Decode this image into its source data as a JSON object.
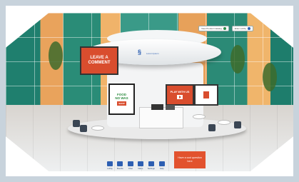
{
  "booth": {
    "leave_comment": "LEAVE A COMMENT",
    "logo_mark": "§",
    "logo_text": "Lorem Ipsum",
    "food_sign_title": "FOOD\nNO WAS",
    "food_sign_tag": "SHOP",
    "play_label": "PLAY WITH US",
    "video_icon": "play-icon",
    "pdf_icon": "pdf-icon"
  },
  "topbar": {
    "items": [
      {
        "label": "View Product Catalog",
        "icon_color": "#2a8c4a"
      },
      {
        "label": "Enter Lobby",
        "icon_color": "#2d5fb2"
      }
    ]
  },
  "cta": {
    "label": "Have a cool question\nhere"
  },
  "dock": {
    "items": [
      {
        "label": "Lobby",
        "icon": "home-icon"
      },
      {
        "label": "Booths",
        "icon": "booth-icon"
      },
      {
        "label": "Chat",
        "icon": "chat-icon"
      },
      {
        "label": "Video",
        "icon": "video-icon"
      },
      {
        "label": "Settings",
        "icon": "gear-icon"
      },
      {
        "label": "Help",
        "icon": "help-icon"
      }
    ]
  }
}
